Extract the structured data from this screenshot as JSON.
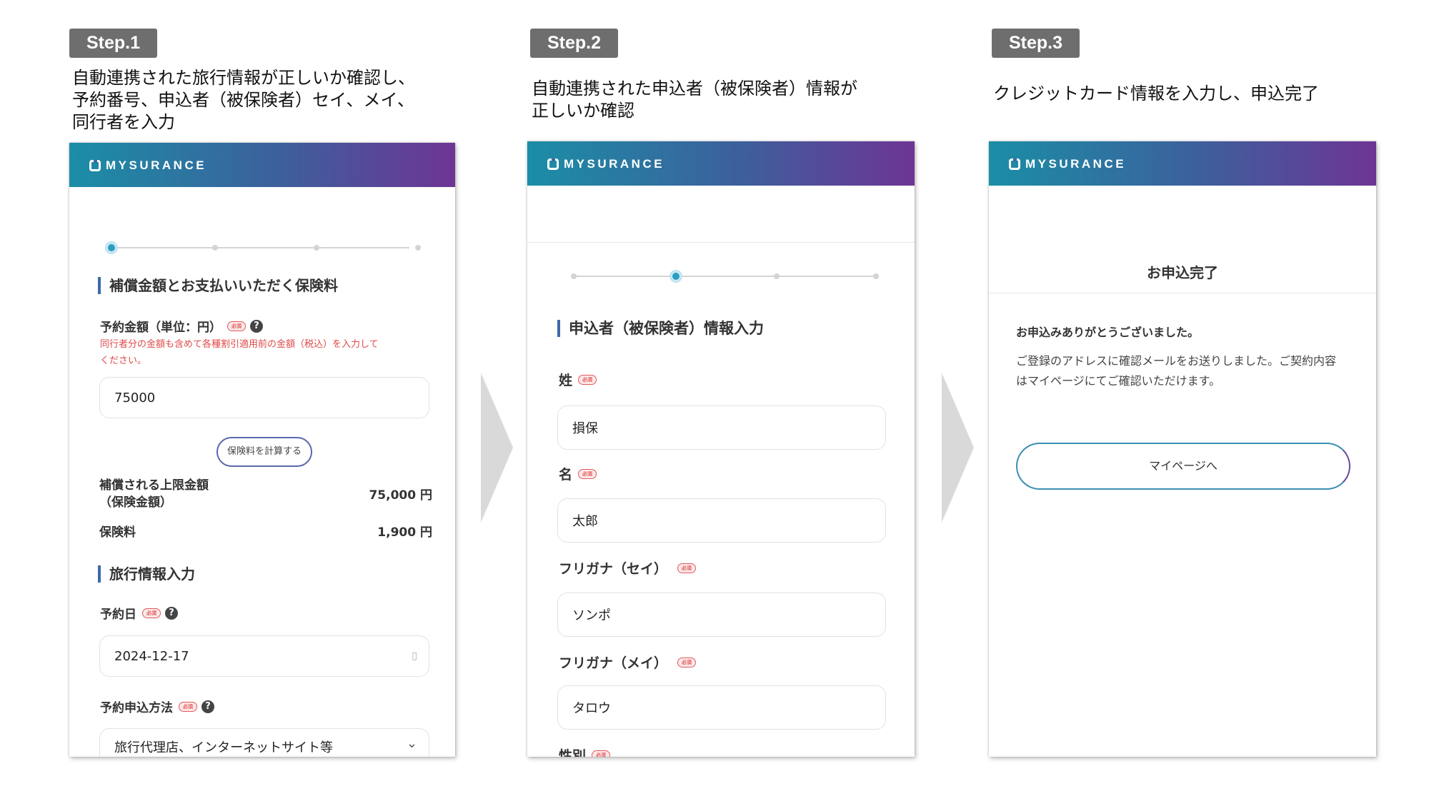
{
  "steps": [
    {
      "badge": "Step.1",
      "description": "自動連携された旅行情報が正しいか確認し、\n予約番号、申込者（被保険者）セイ、メイ、\n同行者を入力"
    },
    {
      "badge": "Step.2",
      "description": "自動連携された申込者（被保険者）情報が\n正しいか確認"
    },
    {
      "badge": "Step.3",
      "description": "クレジットカード情報を入力し、申込完了"
    }
  ],
  "brand": {
    "logo_text": "MYSURANCE"
  },
  "screen1": {
    "progress": {
      "current": 1,
      "total": 4
    },
    "section_coverage_title": "補償金額とお支払いいただく保険料",
    "booking_amount_label": "予約金額（単位：円）",
    "required_badge": "必須",
    "help_mark": "?",
    "booking_amount_note": "同行者分の金額も含めて各種割引適用前の金額（税込）を入力して\nください。",
    "booking_amount_value": "75000",
    "calc_button": "保険料を計算する",
    "insured_limit_label": "補償される上限金額\n（保険金額）",
    "insured_limit_value": "75,000 円",
    "premium_label": "保険料",
    "premium_value": "1,900 円",
    "section_travel_title": "旅行情報入力",
    "booking_date_label": "予約日",
    "booking_date_value": "2024-12-17",
    "booking_method_label": "予約申込方法",
    "booking_method_value": "旅行代理店、インターネットサイト等"
  },
  "screen2": {
    "progress": {
      "current": 2,
      "total": 4
    },
    "section_title": "申込者（被保険者）情報入力",
    "last_name_label": "姓",
    "last_name_value": "損保",
    "first_name_label": "名",
    "first_name_value": "太郎",
    "kana_last_label": "フリガナ（セイ）",
    "kana_last_value": "ソンポ",
    "kana_first_label": "フリガナ（メイ）",
    "kana_first_value": "タロウ",
    "gender_label": "性別"
  },
  "screen3": {
    "title": "お申込完了",
    "thanks": "お申込みありがとうございました。",
    "message": "ご登録のアドレスに確認メールをお送りしました。ご契約内容\nはマイページにてご確認いただけます。",
    "mypage_button": "マイページへ"
  }
}
